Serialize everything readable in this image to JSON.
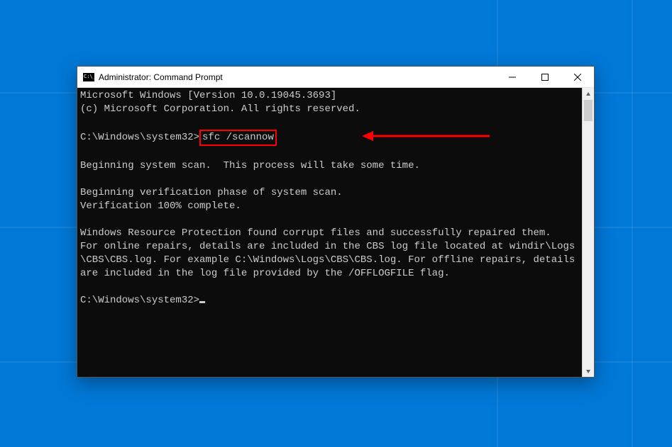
{
  "window": {
    "title": "Administrator: Command Prompt"
  },
  "console": {
    "line_version": "Microsoft Windows [Version 10.0.19045.3693]",
    "line_copyright": "(c) Microsoft Corporation. All rights reserved.",
    "prompt1_path": "C:\\Windows\\system32>",
    "prompt1_cmd": "sfc /scannow",
    "line_begin_scan": "Beginning system scan.  This process will take some time.",
    "line_begin_verify": "Beginning verification phase of system scan.",
    "line_verify_pct": "Verification 100% complete.",
    "line_result1": "Windows Resource Protection found corrupt files and successfully repaired them.",
    "line_result2": "For online repairs, details are included in the CBS log file located at windir\\Logs\\CBS\\CBS.log. For example C:\\Windows\\Logs\\CBS\\CBS.log. For offline repairs, details are included in the log file provided by the /OFFLOGFILE flag.",
    "prompt2_path": "C:\\Windows\\system32>"
  },
  "annotation": {
    "highlight_color": "#ff0000"
  }
}
